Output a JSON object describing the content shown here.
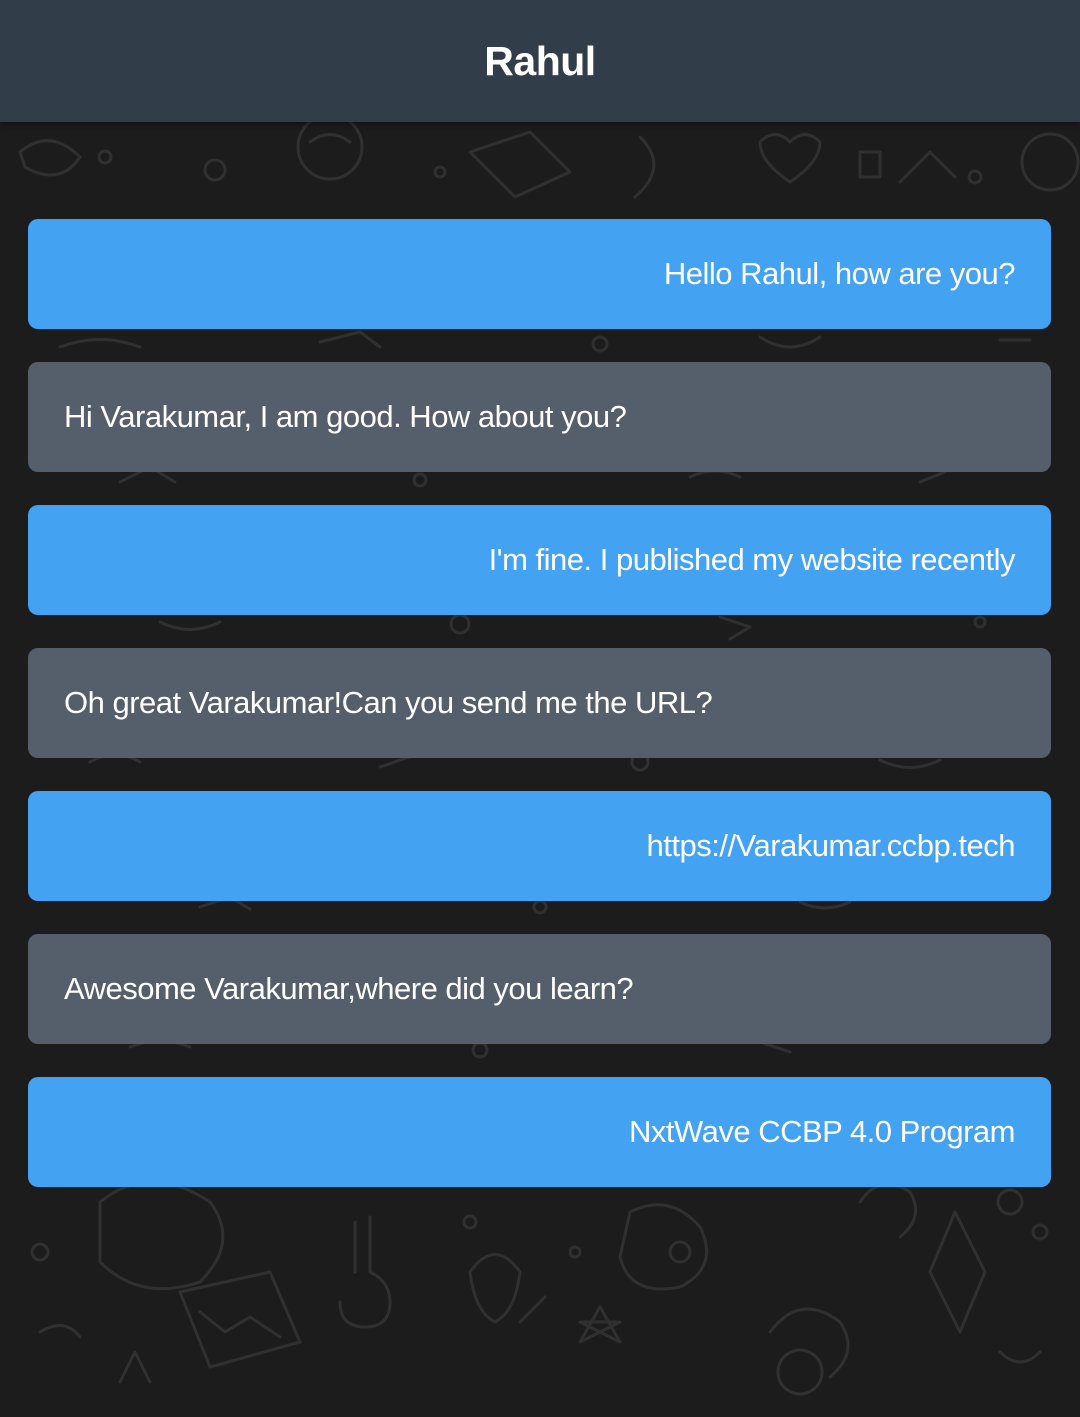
{
  "header": {
    "title": "Rahul"
  },
  "colors": {
    "header_bg": "#323d4a",
    "sent_bubble": "#44a2f3",
    "received_bubble": "#555f6b",
    "message_text": "#ffffff",
    "chat_bg": "#1c1c1c"
  },
  "messages": [
    {
      "side": "sent",
      "text": "Hello Rahul, how are you?"
    },
    {
      "side": "received",
      "text": "Hi Varakumar, I am good. How about you?"
    },
    {
      "side": "sent",
      "text": "I'm fine. I published my website recently"
    },
    {
      "side": "received",
      "text": "Oh great Varakumar!Can you send me the URL?"
    },
    {
      "side": "sent",
      "text": "https://Varakumar.ccbp.tech"
    },
    {
      "side": "received",
      "text": "Awesome Varakumar,where did you learn?"
    },
    {
      "side": "sent",
      "text": "NxtWave CCBP 4.0 Program"
    }
  ]
}
